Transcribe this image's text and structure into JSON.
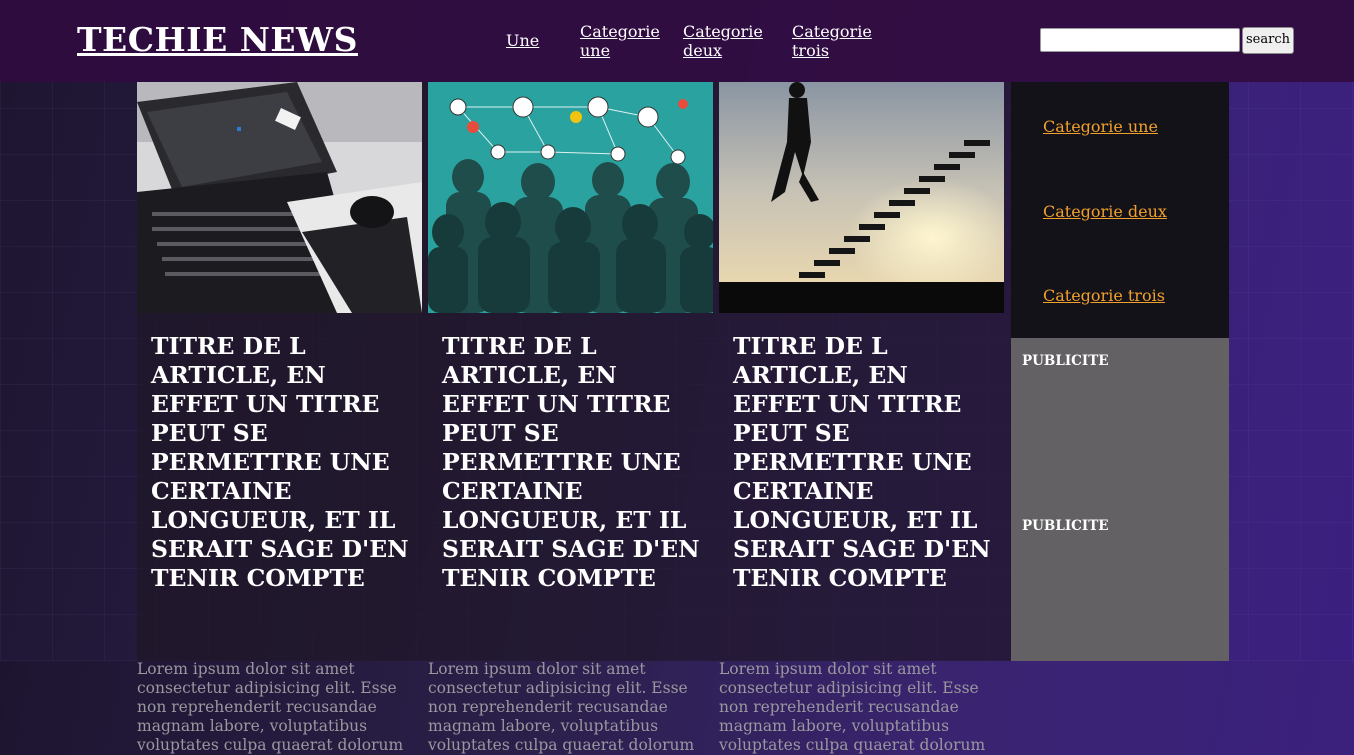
{
  "header": {
    "logo": "TECHIE NEWS",
    "nav": [
      "Une",
      "Categorie une",
      "Categorie deux",
      "Categorie trois"
    ],
    "search_button": "search",
    "search_value": ""
  },
  "articles": [
    {
      "image": "desk-keyboard-laptop-image",
      "title": "TITRE DE L ARTICLE, EN EFFET UN TITRE PEUT SE PERMETTRE UNE CERTAINE LONGUEUR, ET IL SERAIT SAGE D'EN TENIR COMPTE",
      "excerpt": "Lorem ipsum dolor sit amet consectetur adipisicing elit. Esse non reprehenderit recusandae magnam labore, voluptatibus voluptates culpa quaerat dolorum"
    },
    {
      "image": "network-crowd-icons-image",
      "title": "TITRE DE L ARTICLE, EN EFFET UN TITRE PEUT SE PERMETTRE UNE CERTAINE LONGUEUR, ET IL SERAIT SAGE D'EN TENIR COMPTE",
      "excerpt": "Lorem ipsum dolor sit amet consectetur adipisicing elit. Esse non reprehenderit recusandae magnam labore, voluptatibus voluptates culpa quaerat dolorum"
    },
    {
      "image": "man-climbing-stairs-sunset-image",
      "title": "TITRE DE L ARTICLE, EN EFFET UN TITRE PEUT SE PERMETTRE UNE CERTAINE LONGUEUR, ET IL SERAIT SAGE D'EN TENIR COMPTE",
      "excerpt": "Lorem ipsum dolor sit amet consectetur adipisicing elit. Esse non reprehenderit recusandae magnam labore, voluptatibus voluptates culpa quaerat dolorum"
    }
  ],
  "sidebar": {
    "categories": [
      "Categorie une",
      "Categorie deux",
      "Categorie trois"
    ],
    "ads": [
      "PUBLICITE",
      "PUBLICITE"
    ]
  },
  "colors": {
    "header_bg": "#300c40",
    "sidebar_link": "#f0a02c",
    "ad_bg": "#636163",
    "teal": "#2aa3a0"
  }
}
